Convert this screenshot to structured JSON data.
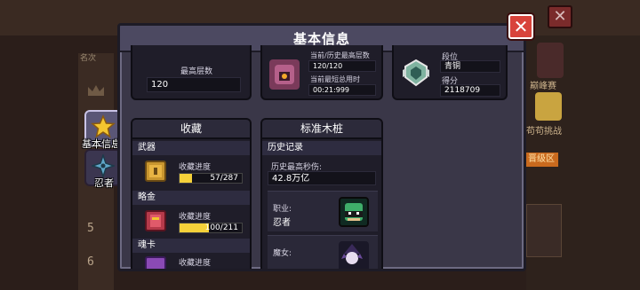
{
  "background": {
    "rank_header": "名次",
    "ranks": [
      "5",
      "6"
    ],
    "right_labels": [
      "巅峰赛",
      "苟苟挑战",
      "晋级区"
    ],
    "close_icon": "close-icon"
  },
  "side_tabs": [
    {
      "label": "基本信息",
      "icon": "star-icon",
      "active": true
    },
    {
      "label": "忍者",
      "icon": "shuriken-icon",
      "active": false
    }
  ],
  "dialog": {
    "title": "基本信息",
    "close_icon": "close-icon",
    "top_left": {
      "label": "最高层数",
      "value": "120"
    },
    "top_middle": {
      "icon": "boss-portrait-icon",
      "floors_label": "当前/历史最高层数",
      "floors_value": "120/120",
      "time_label": "当前最短总用时",
      "time_value": "00:21:999"
    },
    "top_right": {
      "icon": "bronze-rank-badge-icon",
      "rank_label": "段位",
      "rank_value": "青铜",
      "score_label": "得分",
      "score_value": "2118709"
    },
    "collection": {
      "title": "收藏",
      "categories": [
        {
          "name": "武器",
          "progress_label": "收藏进度",
          "progress_text": "57/287",
          "progress": 0.199,
          "icon": "weapon-chest-icon"
        },
        {
          "name": "略金",
          "progress_label": "收藏进度",
          "progress_text": "100/211",
          "progress": 0.474,
          "icon": "red-book-icon"
        },
        {
          "name": "魂卡",
          "progress_label": "收藏进度",
          "icon": "purple-card-icon"
        }
      ]
    },
    "dummy": {
      "title": "标准木桩",
      "history_header": "历史记录",
      "max_dps_label": "历史最高秒伤:",
      "max_dps_value": "42.8万亿",
      "class_label": "职业:",
      "class_value": "忍者",
      "class_icon": "ninja-portrait-icon",
      "witch_label": "魔女:",
      "witch_value": "",
      "witch_icon": "witch-portrait-icon"
    }
  },
  "colors": {
    "dialog_bg": "#3a3748",
    "panel_bg": "#1f1d29",
    "close_red": "#d8433b",
    "progress_yellow": "#f5d13a"
  }
}
